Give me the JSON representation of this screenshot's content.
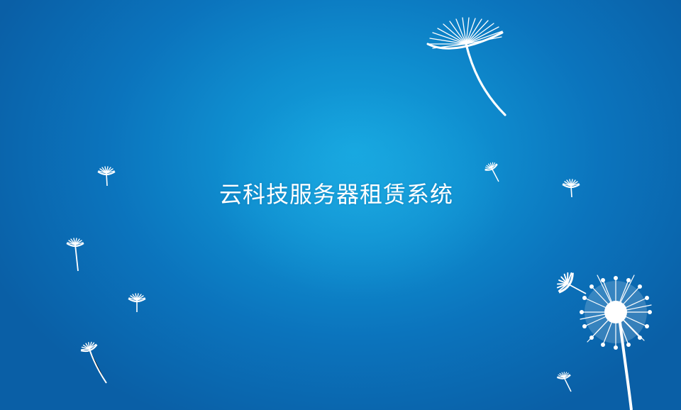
{
  "app": {
    "title": "云科技服务器租赁系统"
  },
  "background": {
    "illustration": "dandelion-seeds",
    "colors": {
      "center": "#14a3dd",
      "edge": "#0a5fa6",
      "seed": "#ffffff"
    }
  }
}
